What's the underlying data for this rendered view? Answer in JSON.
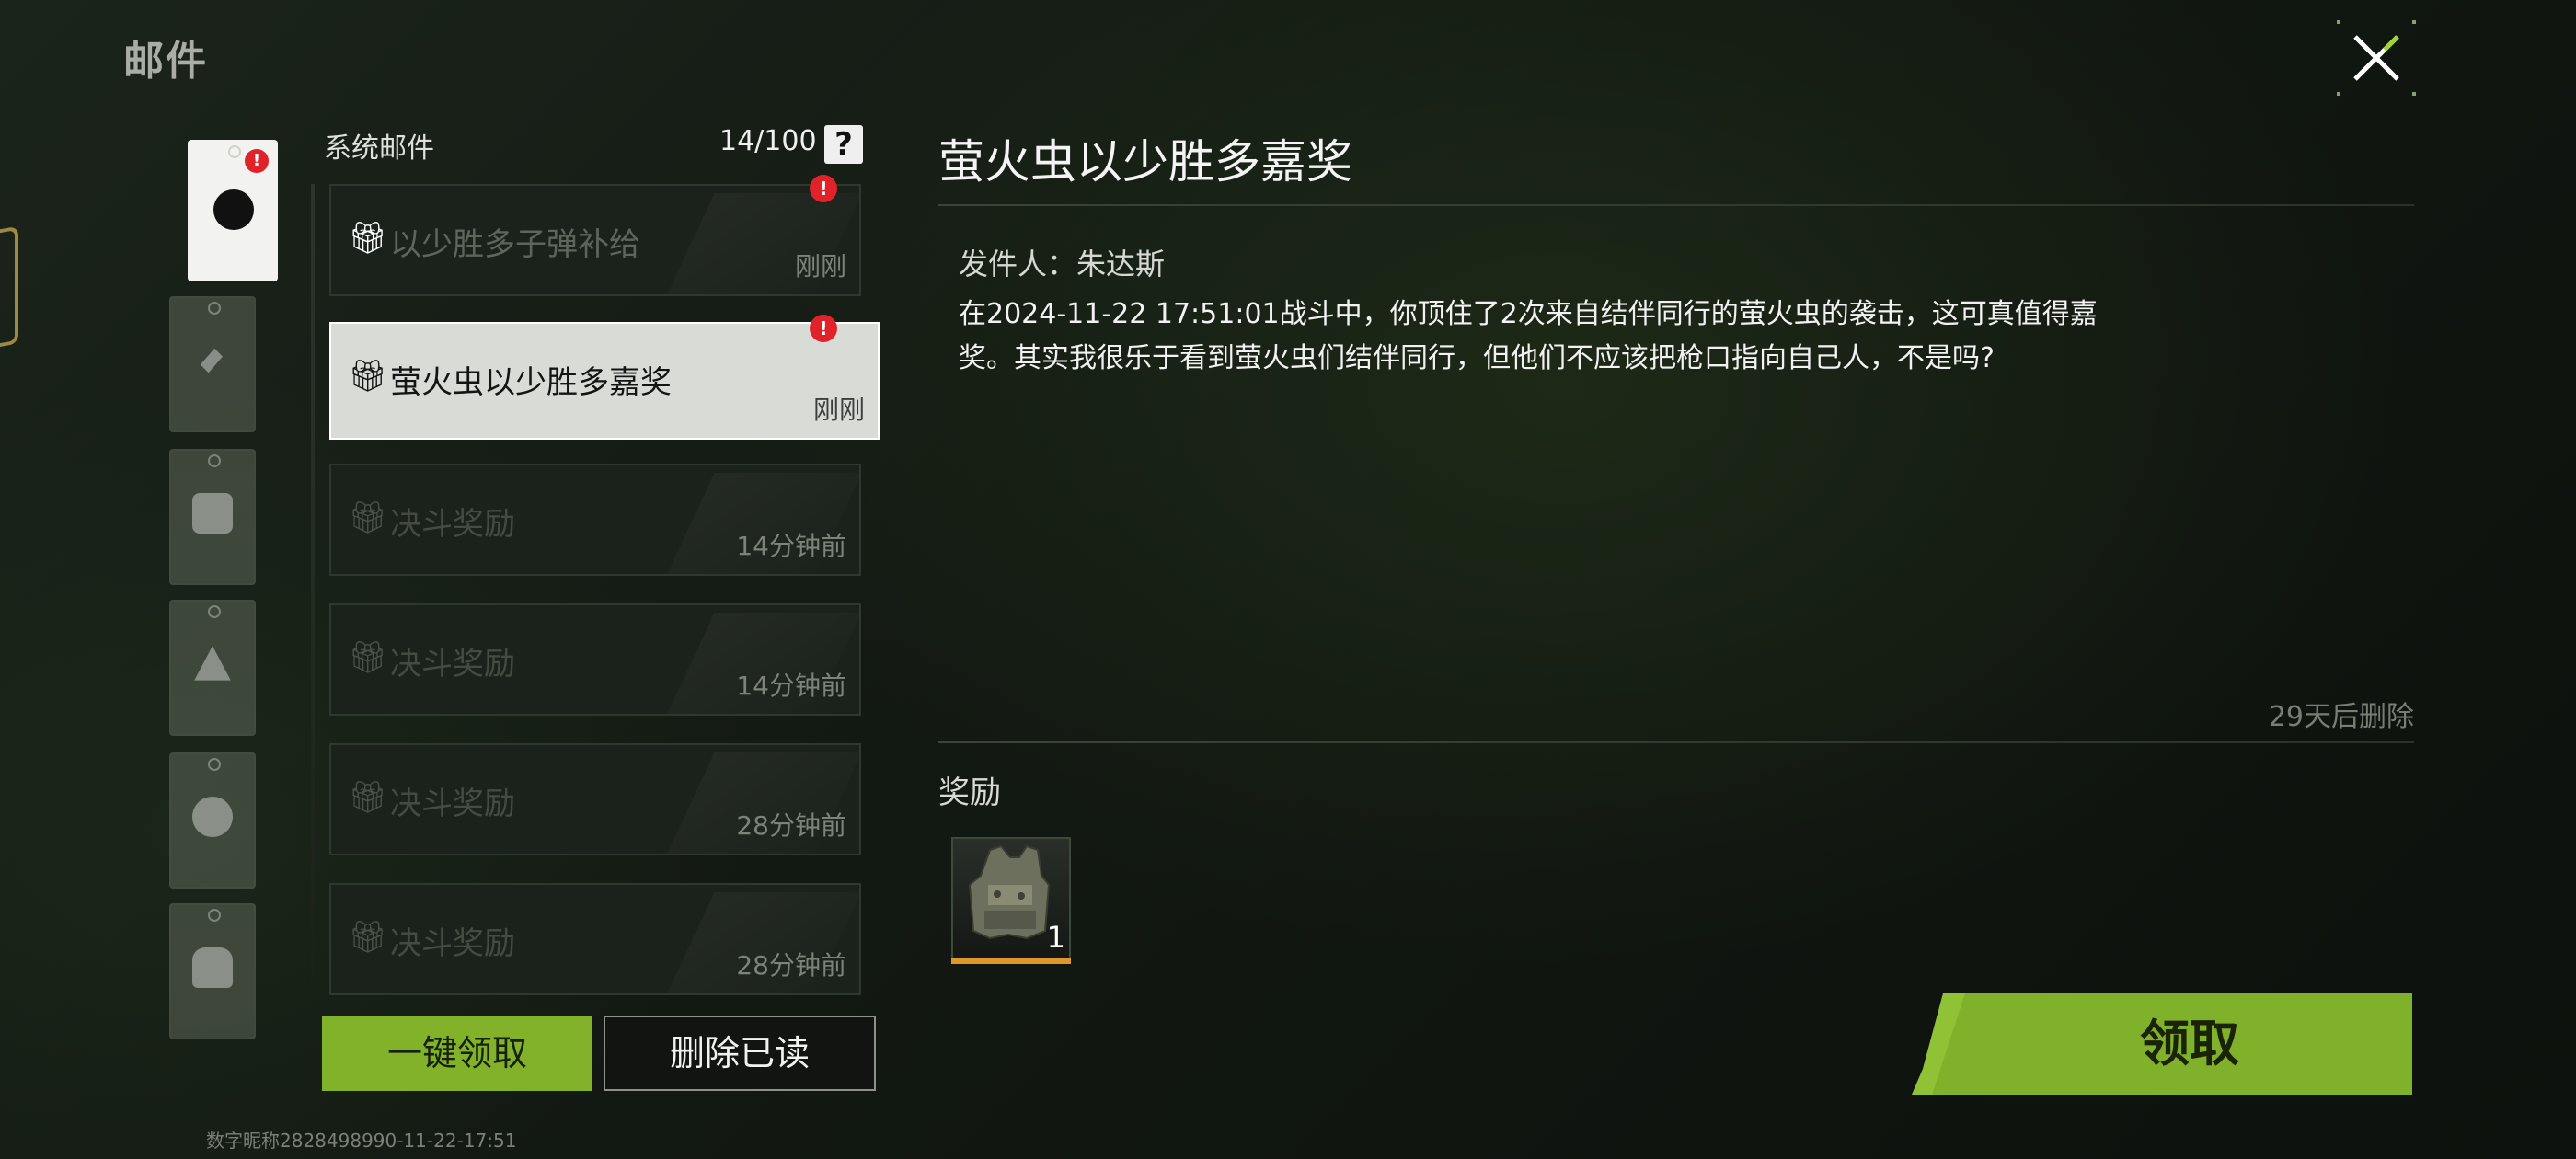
{
  "header": {
    "title": "邮件"
  },
  "list": {
    "heading": "系统邮件",
    "count": "14/100",
    "help": "?",
    "items": [
      {
        "title": "以少胜多子弹补给",
        "time": "刚刚"
      },
      {
        "title": "萤火虫以少胜多嘉奖",
        "time": "刚刚"
      },
      {
        "title": "决斗奖励",
        "time": "14分钟前"
      },
      {
        "title": "决斗奖励",
        "time": "14分钟前"
      },
      {
        "title": "决斗奖励",
        "time": "28分钟前"
      },
      {
        "title": "决斗奖励",
        "time": "28分钟前"
      }
    ],
    "claim_all_label": "一键领取",
    "delete_read_label": "删除已读"
  },
  "footer": {
    "player_id": "数字昵称2828498990-11-22-17:51"
  },
  "detail": {
    "title": "萤火虫以少胜多嘉奖",
    "sender": "发件人：朱达斯",
    "body": "在2024-11-22 17:51:01战斗中，你顶住了2次来自结伴同行的萤火虫的袭击，这可真值得嘉奖。其实我很乐于看到萤火虫们结伴同行，但他们不应该把枪口指向自己人，不是吗?",
    "expire": "29天后删除",
    "reward_label": "奖励",
    "reward_qty": "1",
    "claim_label": "领取"
  },
  "colors": {
    "accent": "#82b229",
    "alert": "#e0232a",
    "rarity": "#e0962b"
  }
}
